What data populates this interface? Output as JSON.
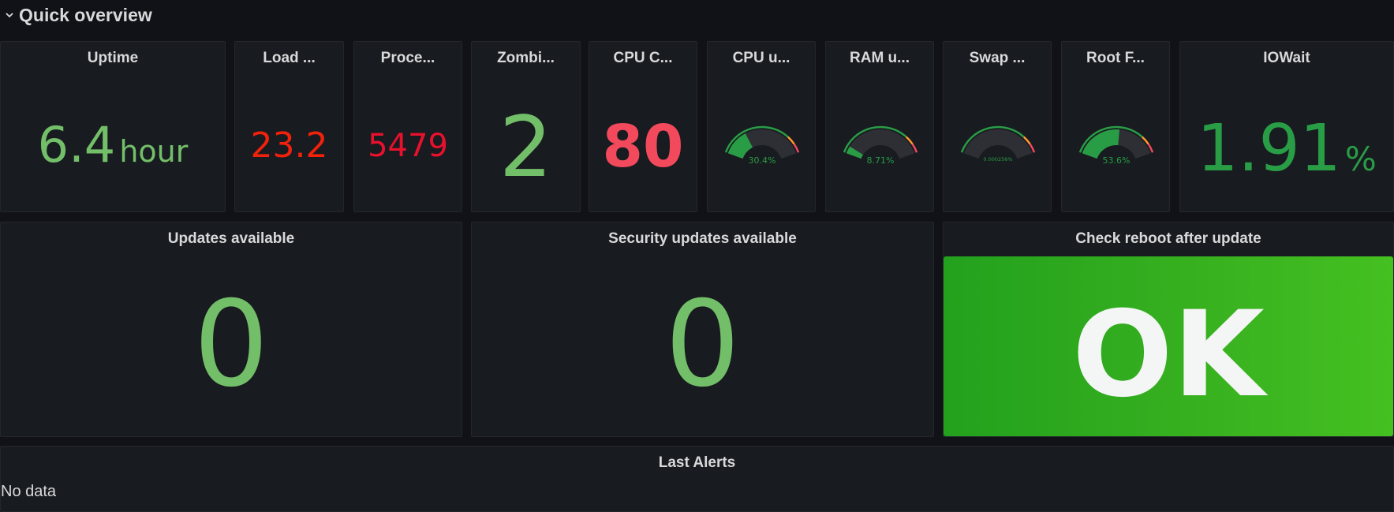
{
  "row": {
    "title": "Quick overview"
  },
  "stats": {
    "uptime": {
      "title": "Uptime",
      "value": "6.4",
      "unit": "hour",
      "color": "#73bf69"
    },
    "load": {
      "title": "Load ...",
      "value": "23.2",
      "color": "#f2210c"
    },
    "processes": {
      "title": "Proce...",
      "value": "5479",
      "color": "#e8112d"
    },
    "zombies": {
      "title": "Zombi...",
      "value": "2",
      "color": "#73bf69"
    },
    "cpu_cores": {
      "title": "CPU C...",
      "value": "80",
      "color": "#f2495c"
    },
    "iowait": {
      "title": "IOWait",
      "value": "1.91",
      "unit": "%",
      "color": "#299c46"
    }
  },
  "gauges": {
    "cpu": {
      "title": "CPU u...",
      "label": "30.4%",
      "percent": 30.4,
      "color": "#299c46"
    },
    "ram": {
      "title": "RAM u...",
      "label": "8.71%",
      "percent": 8.71,
      "color": "#299c46"
    },
    "swap": {
      "title": "Swap ...",
      "label": "0.000256%",
      "percent": 0.000256,
      "color": "#299c46"
    },
    "rootfs": {
      "title": "Root F...",
      "label": "53.6%",
      "percent": 53.6,
      "color": "#299c46"
    }
  },
  "updates": {
    "title": "Updates available",
    "value": "0",
    "color": "#73bf69"
  },
  "security_updates": {
    "title": "Security updates available",
    "value": "0",
    "color": "#73bf69"
  },
  "reboot": {
    "title": "Check reboot after update",
    "value": "OK"
  },
  "alerts": {
    "title": "Last Alerts",
    "empty_text": "No data"
  }
}
